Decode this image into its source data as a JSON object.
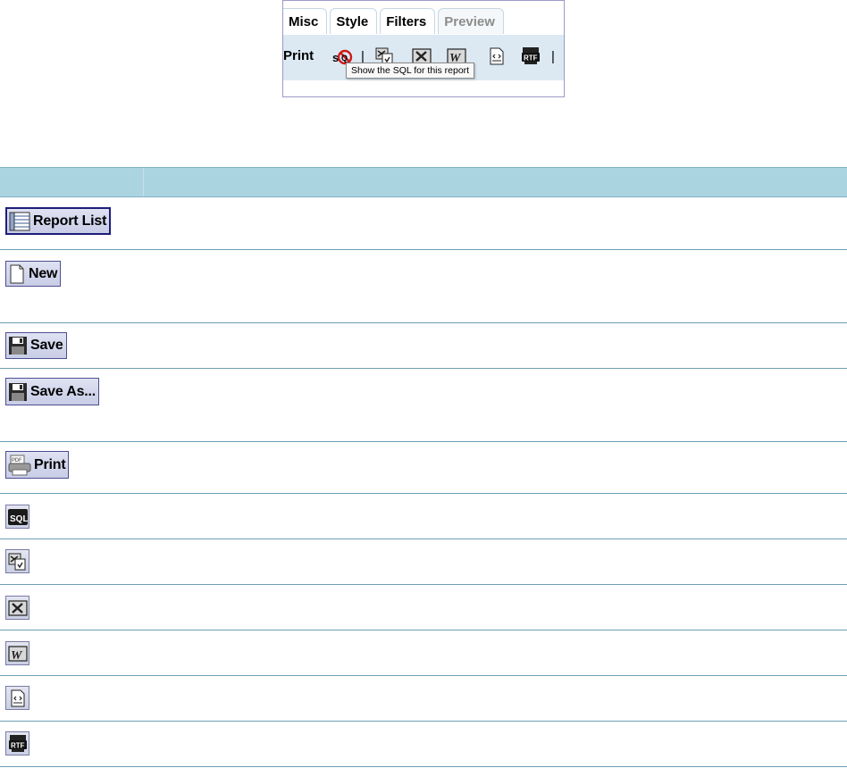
{
  "tabs": [
    {
      "label": "Misc",
      "state": "normal"
    },
    {
      "label": "Style",
      "state": "normal"
    },
    {
      "label": "Filters",
      "state": "normal"
    },
    {
      "label": "Preview",
      "state": "disabled"
    }
  ],
  "toolbar": {
    "print_label": "Print",
    "separator": "|",
    "icons": [
      "sql-disabled-icon",
      "export-html-icon",
      "excel-icon",
      "word-icon",
      "xml-icon",
      "rtf-icon"
    ],
    "tooltip": "Show the SQL for this report"
  },
  "reference_rows": [
    {
      "label": "Report List",
      "icon": "report-list-icon"
    },
    {
      "label": "New",
      "icon": "new-document-icon"
    },
    {
      "label": "Save",
      "icon": "floppy-disk-icon"
    },
    {
      "label": "Save As...",
      "icon": "floppy-disk-icon"
    },
    {
      "label": "Print",
      "icon": "pdf-printer-icon"
    },
    {
      "label": "",
      "icon": "sql-icon"
    },
    {
      "label": "",
      "icon": "export-html-icon"
    },
    {
      "label": "",
      "icon": "excel-icon"
    },
    {
      "label": "",
      "icon": "word-icon"
    },
    {
      "label": "",
      "icon": "xml-icon"
    },
    {
      "label": "",
      "icon": "rtf-icon"
    }
  ],
  "colors": {
    "table_header": "#abd4e1",
    "toolbar_bg": "#dce9f3",
    "button_border": "#4e4e94"
  }
}
